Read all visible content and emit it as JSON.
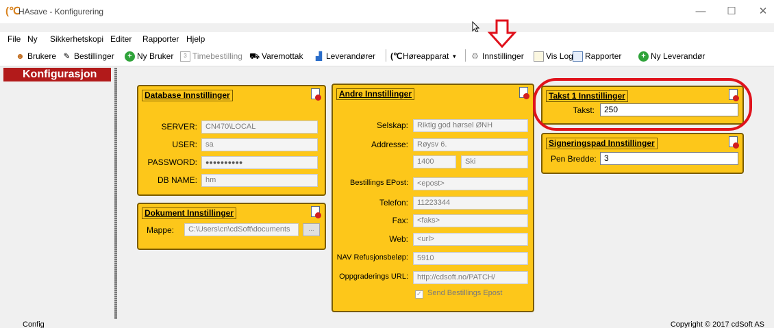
{
  "window": {
    "title": "HAsave - Konfigurering",
    "minimize": "—",
    "maximize": "☐",
    "close": "✕"
  },
  "menu": [
    "File",
    "Ny",
    "Sikkerhetskopi",
    "Editer",
    "Rapporter",
    "Hjelp"
  ],
  "toolbar": {
    "brukere": "Brukere",
    "bestillinger": "Bestillinger",
    "ny_bruker": "Ny Bruker",
    "timebestilling": "Timebestilling",
    "varemottak": "Varemottak",
    "leverandorer": "Leverandører",
    "horeapparat": "Høreapparat",
    "innstillinger": "Innstillinger",
    "vis_log": "Vis Log",
    "rapporter": "Rapporter",
    "ny_leverandor": "Ny Leverandør"
  },
  "sidebar": {
    "heading": "Konfigurasjon"
  },
  "database": {
    "title": "Database Innstillinger",
    "server_label": "SERVER:",
    "server_value": "CN470\\LOCAL",
    "user_label": "USER:",
    "user_value": "sa",
    "password_label": "PASSWORD:",
    "password_value": "●●●●●●●●●●",
    "dbname_label": "DB NAME:",
    "dbname_value": "hm"
  },
  "dokument": {
    "title": "Dokument Innstillinger",
    "mappe_label": "Mappe:",
    "mappe_value": "C:\\Users\\cn\\cdSoft\\documents",
    "browse": "..."
  },
  "andre": {
    "title": "Andre  Innstillinger",
    "selskap_label": "Selskap:",
    "selskap_value": "Riktig god hørsel ØNH",
    "adresse_label": "Addresse:",
    "adresse_value": "Røysv 6.",
    "postnr_value": "1400",
    "poststed_value": "Ski",
    "epost_label": "Bestillings EPost:",
    "epost_value": "<epost>",
    "telefon_label": "Telefon:",
    "telefon_value": "11223344",
    "fax_label": "Fax:",
    "fax_value": "<faks>",
    "web_label": "Web:",
    "web_value": "<url>",
    "nav_label": "NAV Refusjonsbeløp:",
    "nav_value": "5910",
    "url_label": "Oppgraderings URL:",
    "url_value": "http://cdsoft.no/PATCH/",
    "send_label": "Send Bestillings Epost"
  },
  "takst": {
    "title": "Takst 1 Innstillinger",
    "label": "Takst:",
    "value": "250"
  },
  "signering": {
    "title": "Signeringspad Innstillinger",
    "label": "Pen Bredde:",
    "value": "3"
  },
  "status": {
    "left": "Config",
    "right": "Copyright © 2017 cdSoft AS"
  },
  "colors": {
    "panel": "#fdc71a",
    "sidebar_header": "#b21a1a",
    "annotation": "#e0121c"
  }
}
